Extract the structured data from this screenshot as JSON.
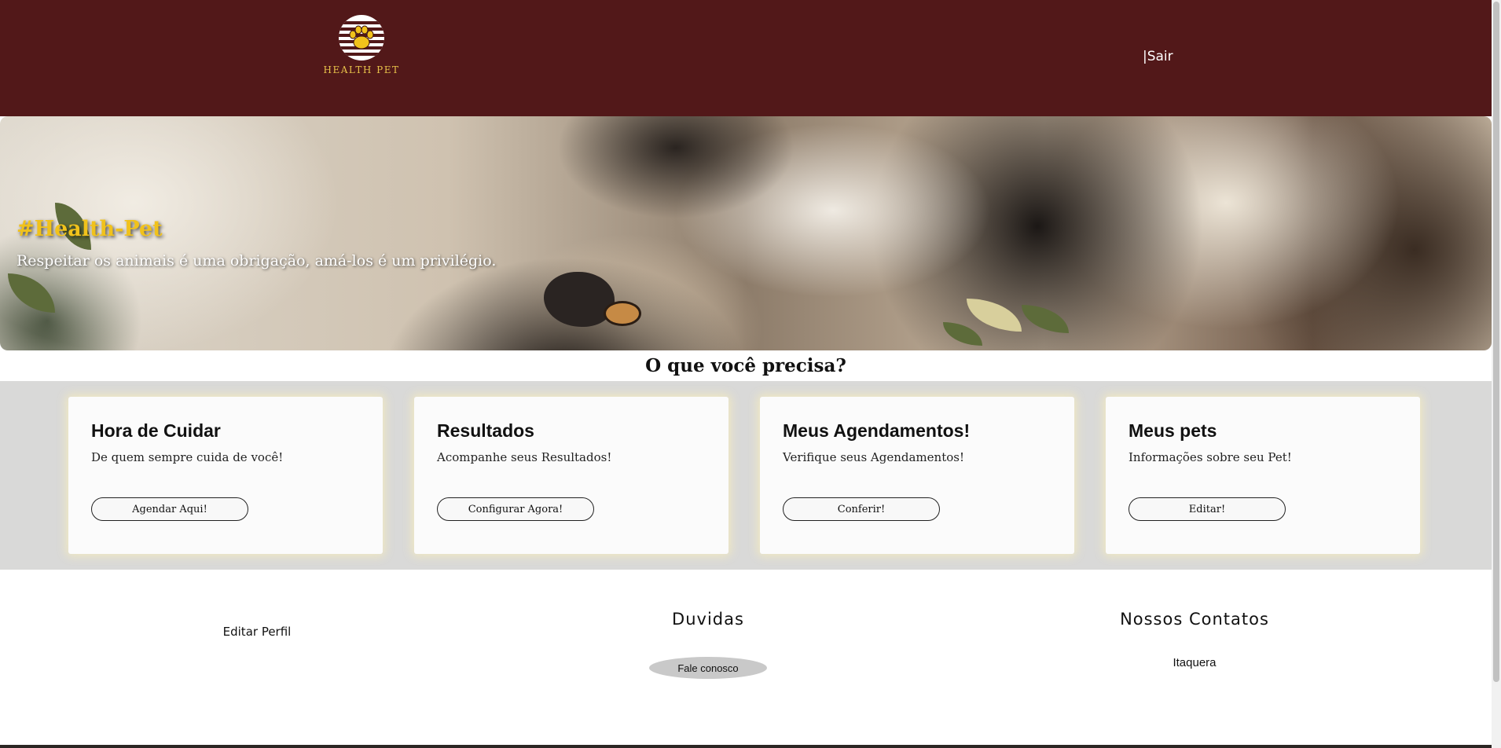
{
  "header": {
    "logo_text": "HEALTH PET",
    "logout_label": "|Sair"
  },
  "hero": {
    "title": "#Health-Pet",
    "subtitle": "Respeitar os animais é uma obrigação, amá-los é um privilégio."
  },
  "section_title": "O que você precisa?",
  "cards": [
    {
      "title": "Hora de Cuidar",
      "text": "De quem sempre cuida de você!",
      "button": "Agendar Aqui!"
    },
    {
      "title": "Resultados",
      "text": "Acompanhe seus Resultados!",
      "button": "Configurar Agora!"
    },
    {
      "title": "Meus Agendamentos!",
      "text": "Verifique seus Agendamentos!",
      "button": "Conferir!"
    },
    {
      "title": "Meus pets",
      "text": "Informações sobre seu Pet!",
      "button": "Editar!"
    }
  ],
  "footer": {
    "edit_profile": "Editar Perfil",
    "doubts_heading": "Duvidas",
    "contact_button": "Fale conosco",
    "contacts_heading": "Nossos Contatos",
    "contact_location": "Itaquera"
  },
  "colors": {
    "header_bg": "#521819",
    "accent_gold": "#f1c21b",
    "cards_band_bg": "#d9d9d8"
  }
}
